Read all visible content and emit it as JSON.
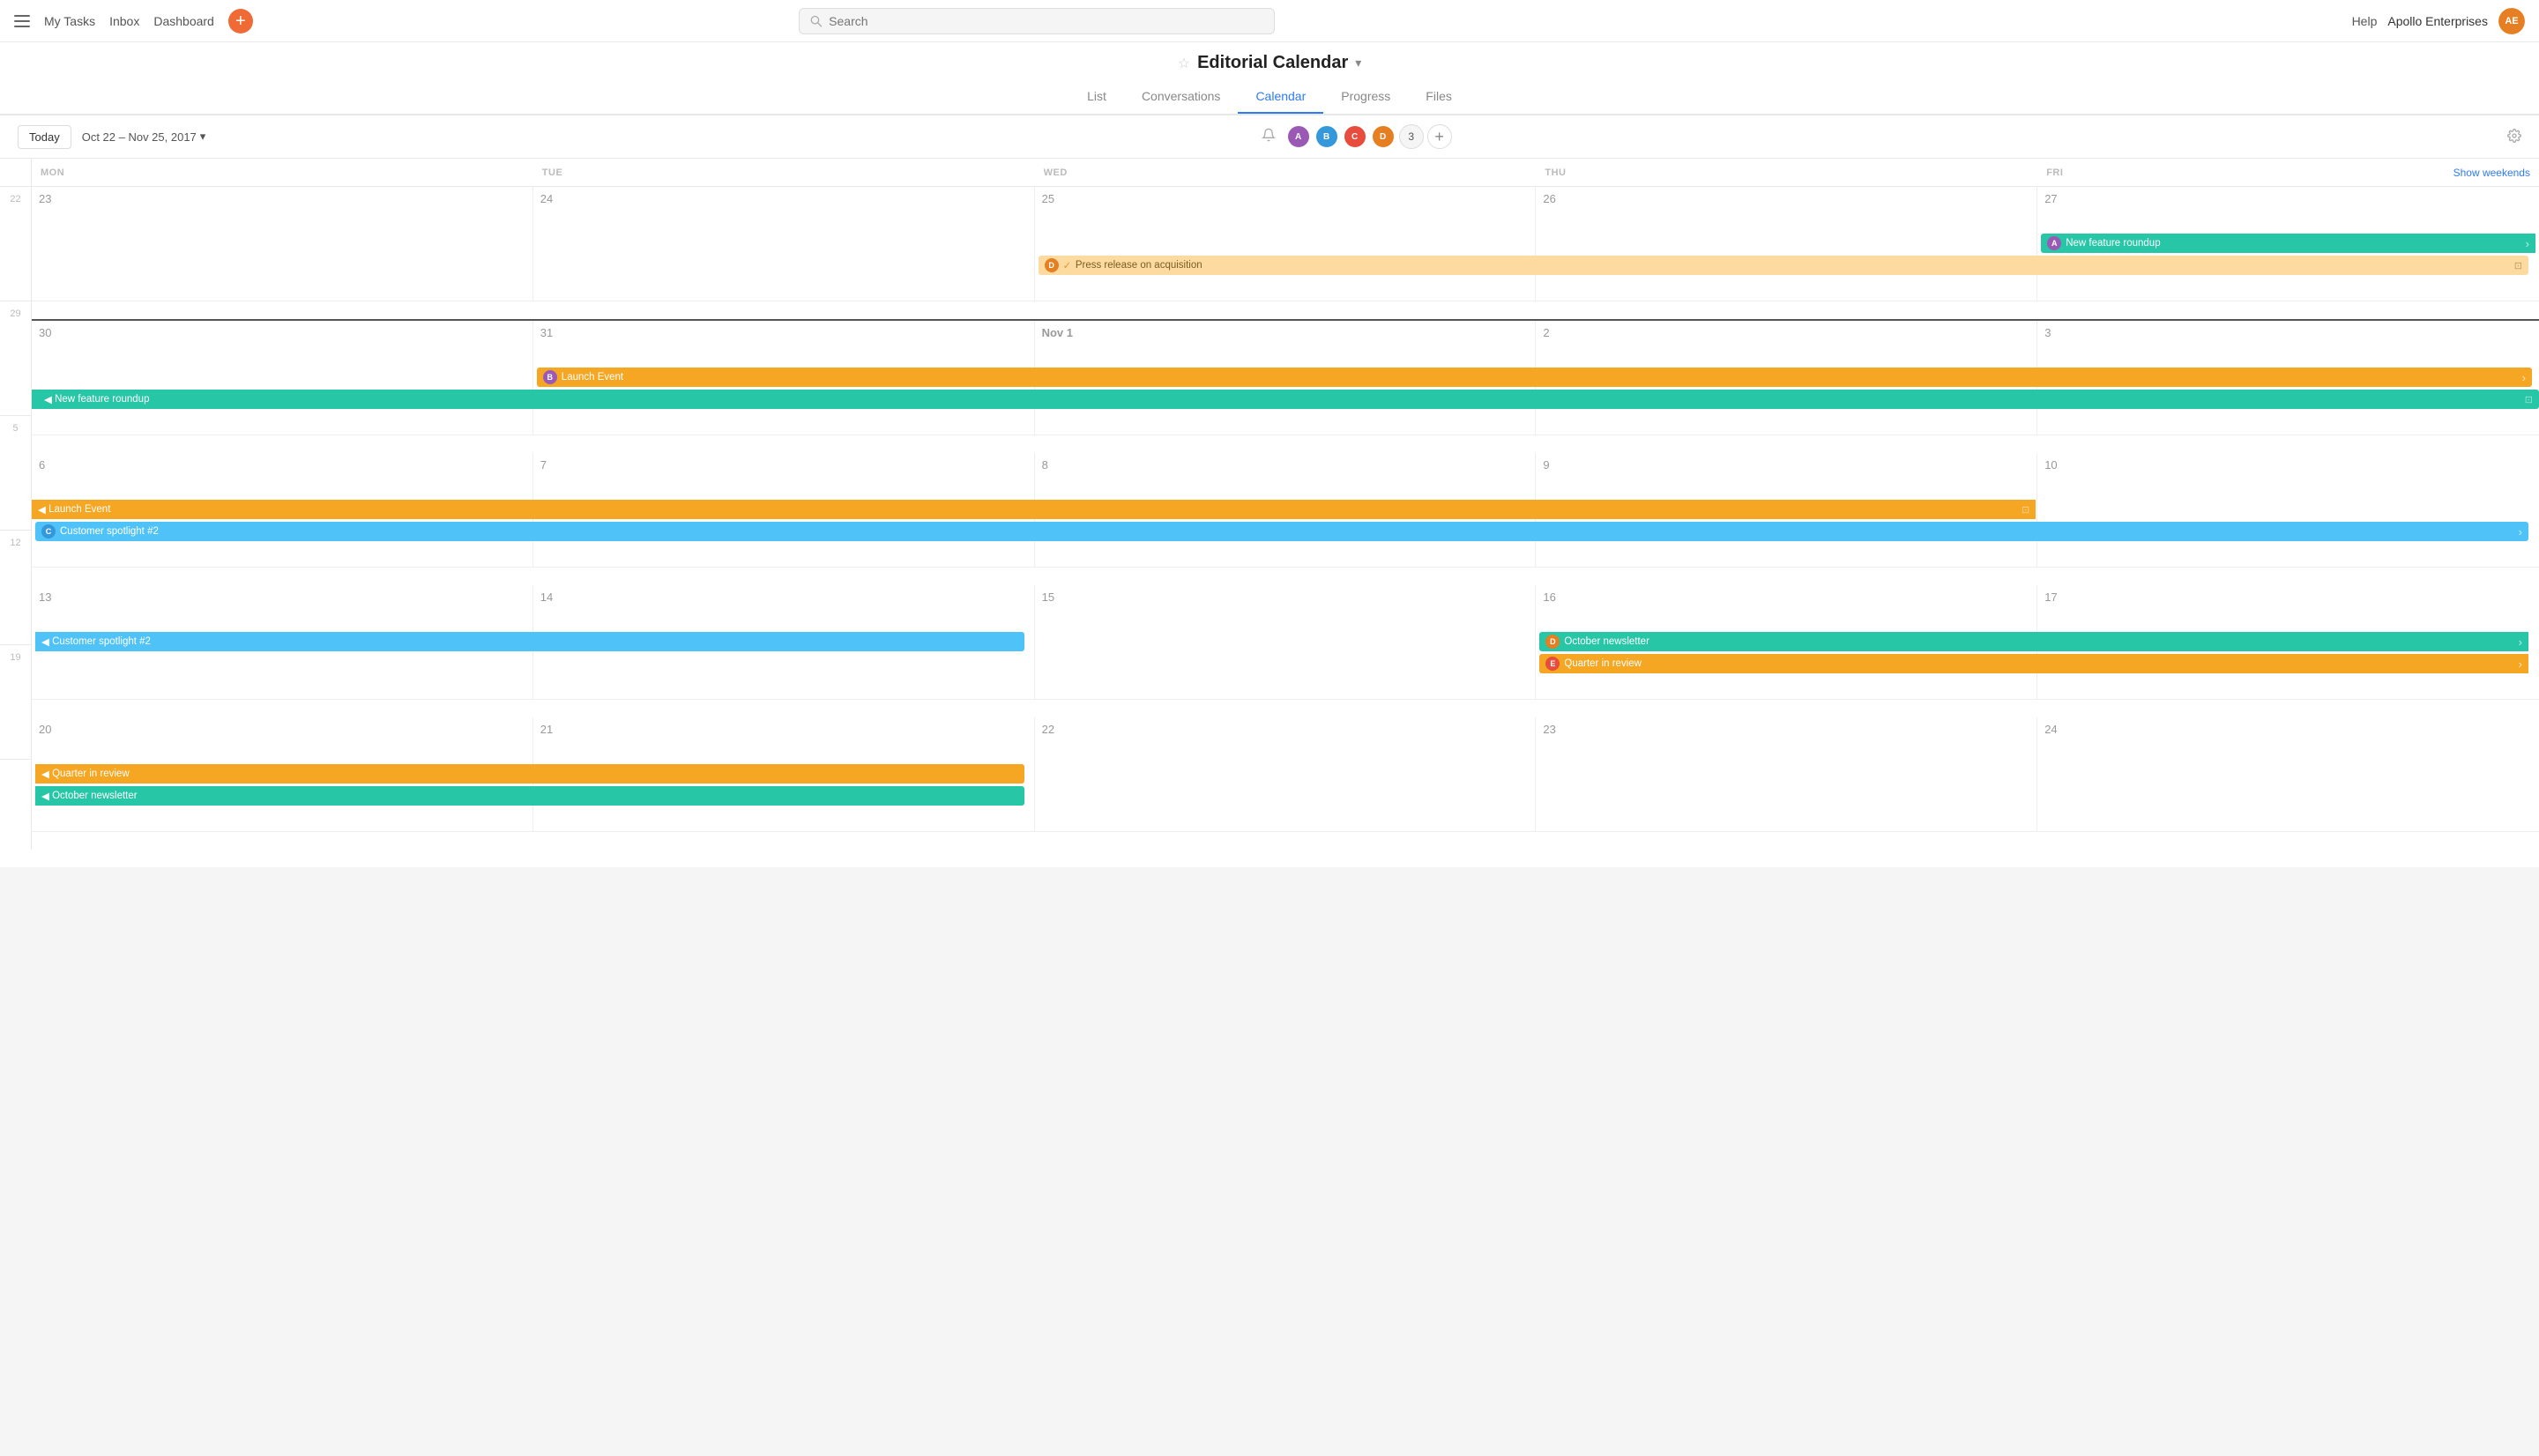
{
  "nav": {
    "my_tasks": "My Tasks",
    "inbox": "Inbox",
    "dashboard": "Dashboard",
    "help": "Help",
    "org_name": "Apollo Enterprises"
  },
  "search": {
    "placeholder": "Search"
  },
  "page": {
    "title": "Editorial Calendar",
    "tabs": [
      "List",
      "Conversations",
      "Calendar",
      "Progress",
      "Files"
    ]
  },
  "toolbar": {
    "today_label": "Today",
    "date_range": "Oct 22 – Nov 25, 2017",
    "show_weekends": "Show weekends"
  },
  "col_headers": [
    "MON",
    "TUE",
    "WED",
    "THU",
    "FRI"
  ],
  "weeks": [
    {
      "num": "22",
      "days": [
        {
          "num": "23"
        },
        {
          "num": "24"
        },
        {
          "num": "25"
        },
        {
          "num": "26"
        },
        {
          "num": "27"
        }
      ],
      "events": [
        {
          "label": "New feature roundup",
          "color": "teal",
          "start": 4,
          "end": 4,
          "avatar": true,
          "arrow": true
        },
        {
          "label": "Press release on acquisition",
          "color": "peach",
          "start": 2,
          "end": 4,
          "avatar": true,
          "check": true,
          "sq": true
        }
      ]
    },
    {
      "num": "29",
      "days": [
        {
          "num": "30"
        },
        {
          "num": "31"
        },
        {
          "num": "Nov 1",
          "today": true
        },
        {
          "num": "2"
        },
        {
          "num": "3"
        }
      ],
      "events": [
        {
          "label": "Launch Event",
          "color": "orange",
          "start": 1,
          "end": 4,
          "avatar": true,
          "arrow": true
        },
        {
          "label": "New feature roundup",
          "color": "teal",
          "start": 0,
          "end": 4,
          "cl": true,
          "sq": true
        }
      ]
    },
    {
      "num": "5",
      "days": [
        {
          "num": "6"
        },
        {
          "num": "7"
        },
        {
          "num": "8"
        },
        {
          "num": "9"
        },
        {
          "num": "10"
        }
      ],
      "events": [
        {
          "label": "Launch Event",
          "color": "orange",
          "start": 0,
          "end": 3,
          "cl": true,
          "sq": true
        },
        {
          "label": "Customer spotlight #2",
          "color": "blue",
          "start": 0,
          "end": 4,
          "avatar": true,
          "arrow": true
        }
      ]
    },
    {
      "num": "12",
      "days": [
        {
          "num": "13"
        },
        {
          "num": "14"
        },
        {
          "num": "15"
        },
        {
          "num": "16"
        },
        {
          "num": "17"
        }
      ],
      "events": [
        {
          "label": "Customer spotlight #2",
          "color": "blue",
          "start": 0,
          "end": 1,
          "cl": true
        },
        {
          "label": "October newsletter",
          "color": "teal",
          "start": 3,
          "end": 4,
          "avatar": true,
          "arrow": true
        },
        {
          "label": "Quarter in review",
          "color": "orange",
          "start": 3,
          "end": 4,
          "avatar": true,
          "arrow": true
        }
      ]
    },
    {
      "num": "19",
      "days": [
        {
          "num": "20"
        },
        {
          "num": "21"
        },
        {
          "num": "22"
        },
        {
          "num": "23"
        },
        {
          "num": "24"
        }
      ],
      "events": [
        {
          "label": "Quarter in review",
          "color": "orange",
          "start": 0,
          "end": 1,
          "cl": true
        },
        {
          "label": "October newsletter",
          "color": "teal",
          "start": 0,
          "end": 1,
          "cl": true
        }
      ]
    }
  ],
  "avatars": {
    "colors": [
      "#e67e22",
      "#9b59b6",
      "#3498db",
      "#e74c3c",
      "#27ae60"
    ]
  }
}
